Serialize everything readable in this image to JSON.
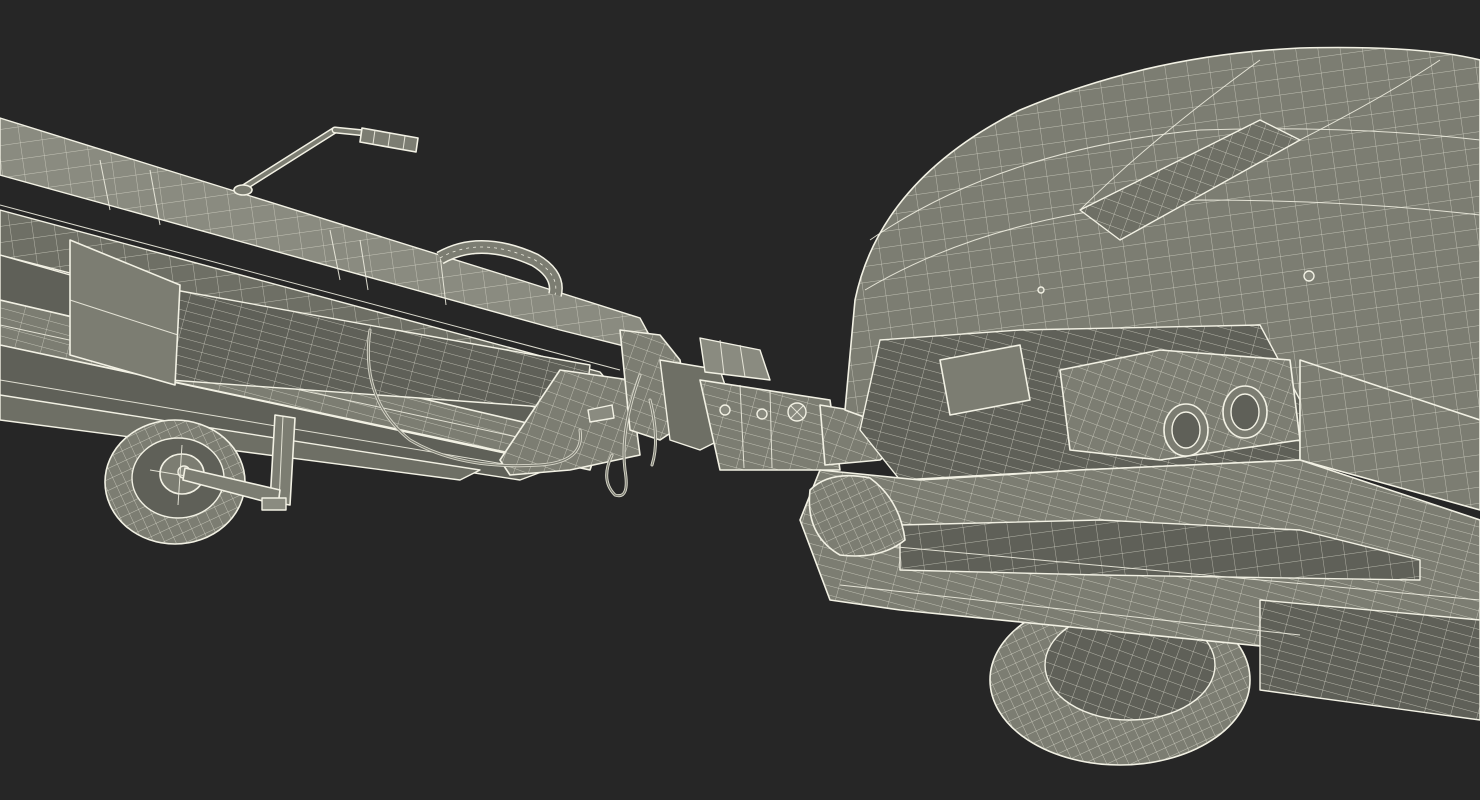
{
  "scene": {
    "background_color": "#262626",
    "mesh_fill_color": "#7c7d72",
    "wireframe_color": "#f2f1e4",
    "objects": [
      "tow-bar-trailer",
      "car-rear"
    ]
  }
}
